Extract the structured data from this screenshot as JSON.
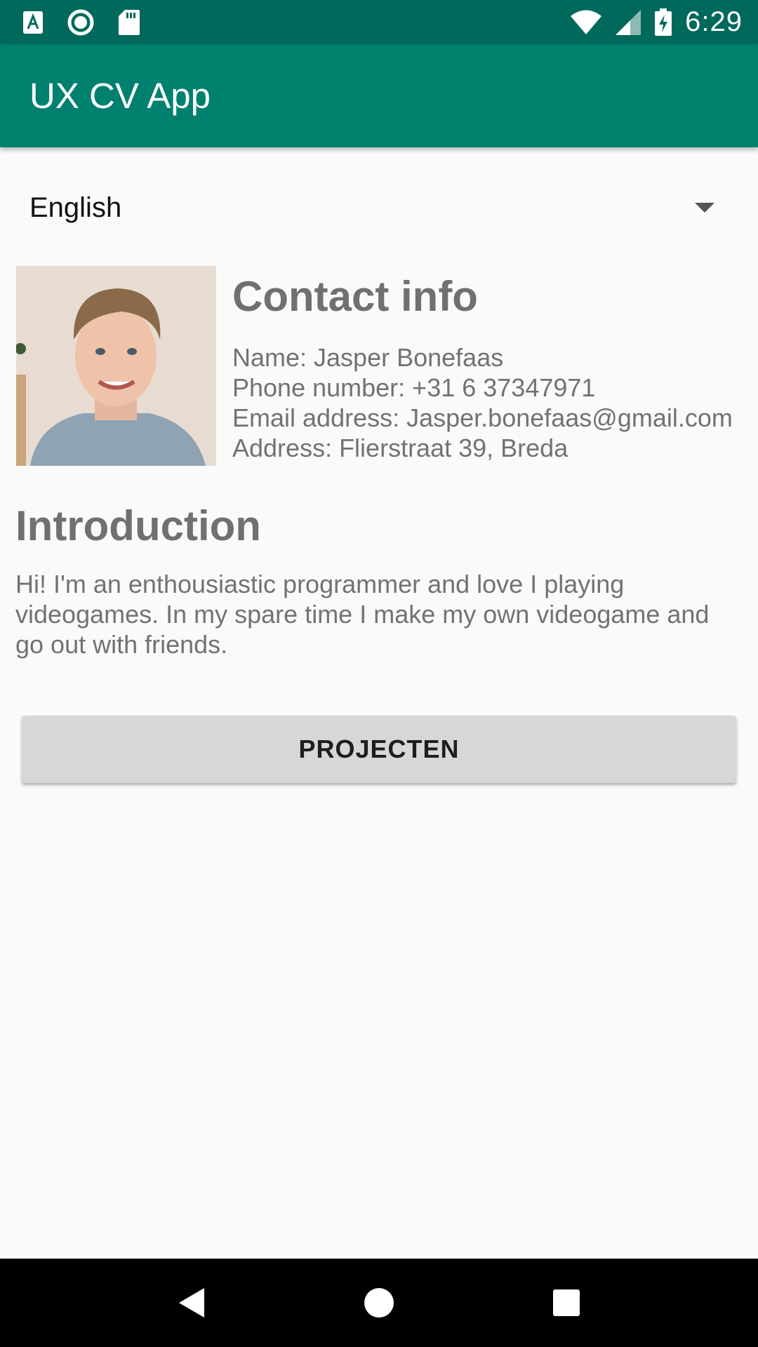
{
  "status_bar": {
    "time": "6:29",
    "icons": [
      "accessibility-a-icon",
      "sync-circle-icon",
      "sd-card-icon",
      "wifi-icon",
      "cell-signal-icon",
      "battery-charging-icon"
    ]
  },
  "app_bar": {
    "title": "UX CV App"
  },
  "language_spinner": {
    "selected": "English"
  },
  "contact": {
    "heading": "Contact info",
    "name": "Name: Jasper Bonefaas",
    "phone": "Phone number: +31 6 37347971",
    "email": "Email address: Jasper.bonefaas@gmail.com",
    "address": "Address: Flierstraat 39, Breda"
  },
  "introduction": {
    "heading": "Introduction",
    "text": "Hi! I'm an enthousiastic programmer and love I playing videogames. In my spare time I make my own videogame and go out with friends."
  },
  "buttons": {
    "projecten": "PROJECTEN"
  },
  "nav_bar": {
    "icons": [
      "back-icon",
      "home-icon",
      "recents-icon"
    ]
  },
  "colors": {
    "status_bar": "#00695c",
    "app_bar": "#00806f",
    "background": "#fafafa",
    "heading_text": "#707070",
    "button": "#d6d7d7"
  }
}
